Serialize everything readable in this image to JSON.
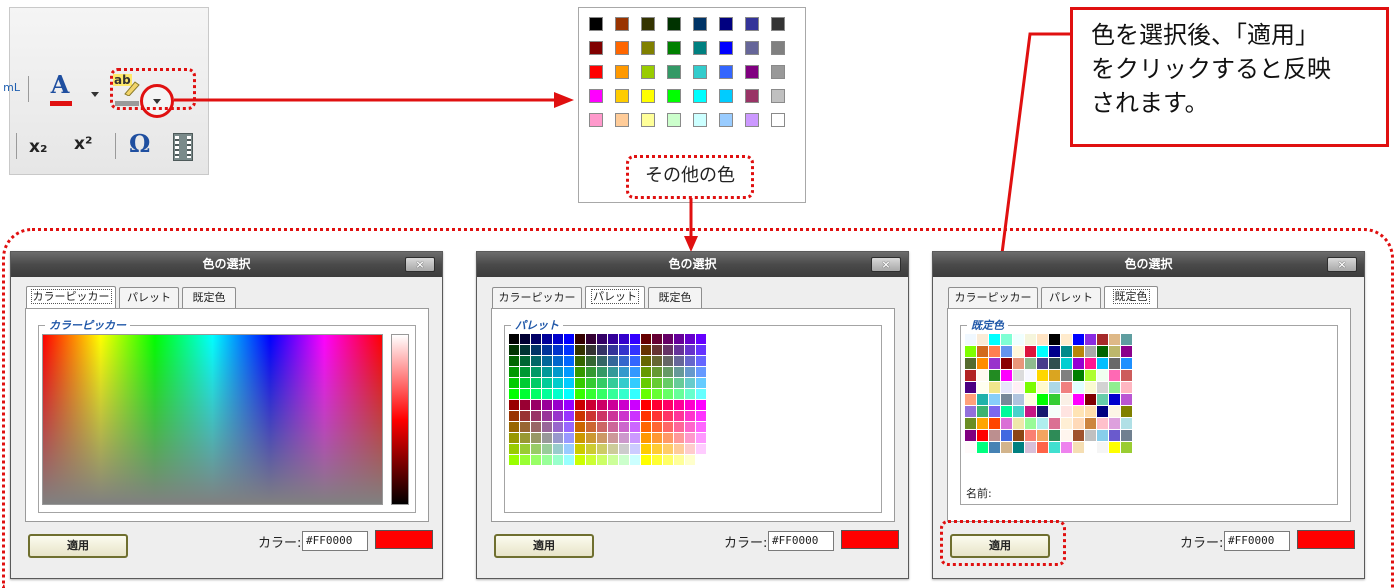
{
  "toolbar": {
    "html_label": "mL",
    "font_color_glyph": "A",
    "bg_color_glyph": "ab",
    "subscript_glyph": "x₂",
    "superscript_glyph": "x²",
    "special_char_glyph": "Ω"
  },
  "popup": {
    "rows": [
      [
        "#000000",
        "#993300",
        "#333300",
        "#003300",
        "#003366",
        "#000080",
        "#333399",
        "#333333"
      ],
      [
        "#800000",
        "#ff6600",
        "#808000",
        "#008000",
        "#008080",
        "#0000ff",
        "#666699",
        "#808080"
      ],
      [
        "#ff0000",
        "#ff9900",
        "#99cc00",
        "#339966",
        "#33cccc",
        "#3366ff",
        "#800080",
        "#999999"
      ],
      [
        "#ff00ff",
        "#ffcc00",
        "#ffff00",
        "#00ff00",
        "#00ffff",
        "#00ccff",
        "#993366",
        "#c0c0c0"
      ],
      [
        "#ff99cc",
        "#ffcc99",
        "#ffff99",
        "#ccffcc",
        "#ccffff",
        "#99ccff",
        "#cc99ff",
        "#ffffff"
      ]
    ],
    "more_colors": "その他の色"
  },
  "annotation": {
    "text": "色を選択後、「適用」\nをクリックすると反映\nされます。"
  },
  "dialogs": [
    {
      "title": "色の選択",
      "close": "×",
      "tabs": [
        "カラーピッカー",
        "パレット",
        "既定色"
      ],
      "active_tab": 0,
      "legend": "カラーピッカー",
      "apply": "適用",
      "color_label": "カラー:",
      "color_value": "#FF0000",
      "preview_color": "#ff0000"
    },
    {
      "title": "色の選択",
      "close": "×",
      "tabs": [
        "カラーピッカー",
        "パレット",
        "既定色"
      ],
      "active_tab": 1,
      "legend": "パレット",
      "apply": "適用",
      "color_label": "カラー:",
      "color_value": "#FF0000",
      "preview_color": "#ff0000"
    },
    {
      "title": "色の選択",
      "close": "×",
      "tabs": [
        "カラーピッカー",
        "パレット",
        "既定色"
      ],
      "active_tab": 2,
      "legend": "既定色",
      "name_label": "名前:",
      "apply": "適用",
      "color_label": "カラー:",
      "color_value": "#FF0000",
      "preview_color": "#ff0000"
    }
  ],
  "colors": {
    "accent_red": "#e01010",
    "title_bar": "#4a4a4a",
    "legend_blue": "#1f57a8"
  }
}
